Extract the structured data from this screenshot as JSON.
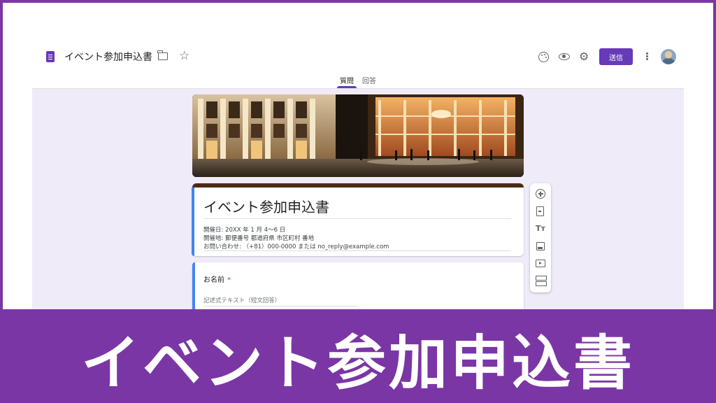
{
  "header": {
    "doc_title": "イベント参加申込書",
    "send_label": "送信"
  },
  "tabs": [
    {
      "label": "質問",
      "active": true
    },
    {
      "label": "回答",
      "active": false
    }
  ],
  "form": {
    "title": "イベント参加申込書",
    "description": [
      "開催日: 20XX 年 1 月 4～6 日",
      "開催地: 郵便番号 都道府県 市区町村 番地",
      "お問い合わせ: （+81）000-0000 または no_reply@example.com"
    ],
    "questions": [
      {
        "label": "お名前",
        "required_mark": "*",
        "placeholder": "記述式テキスト（短文回答）"
      }
    ]
  },
  "toolbar_tools": {
    "title_glyph": "Tт"
  },
  "banner": {
    "title": "イベント参加申込書"
  },
  "colors": {
    "accent": "#673ab7",
    "frame": "#7b36a6",
    "card_accent": "#4285f4",
    "header_border": "#4b2b14",
    "required": "#d93025"
  }
}
